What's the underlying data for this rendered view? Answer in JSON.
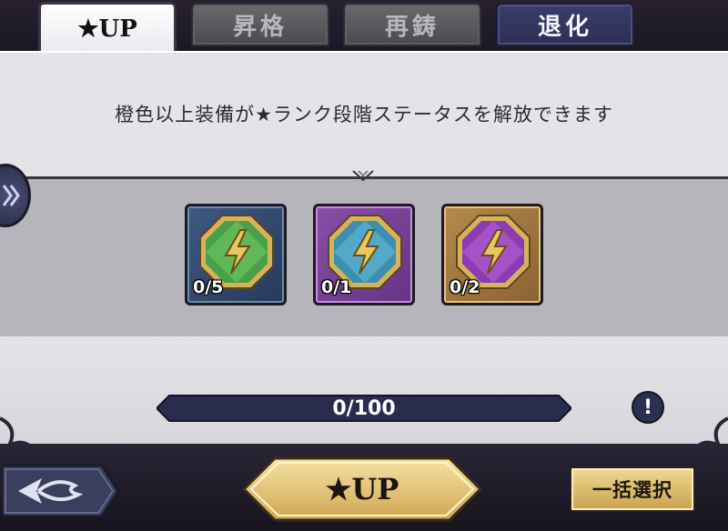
{
  "tabs": [
    {
      "label": "★UP",
      "active": true
    },
    {
      "label": "昇格",
      "active": false
    },
    {
      "label": "再鋳",
      "active": false
    },
    {
      "label": "退化",
      "active": false
    }
  ],
  "description": "橙色以上装備が★ランク段階ステータスを解放できます",
  "materials": [
    {
      "count": "0/5",
      "frame": "blue",
      "gem": "green",
      "icon": "lightning-icon"
    },
    {
      "count": "0/1",
      "frame": "purple",
      "gem": "blue",
      "icon": "lightning-icon"
    },
    {
      "count": "0/2",
      "frame": "gold",
      "gem": "purple",
      "icon": "lightning-icon"
    }
  ],
  "progress": {
    "text": "0/100",
    "fraction": 0.0
  },
  "info_button": "!",
  "buttons": {
    "star_up": "★UP",
    "batch_select": "一括選択"
  },
  "colors": {
    "accent_gold": "#e6c377",
    "panel_light": "#e3e3e8",
    "panel_mid": "#b5b5bb",
    "dark_navy": "#26284a"
  }
}
